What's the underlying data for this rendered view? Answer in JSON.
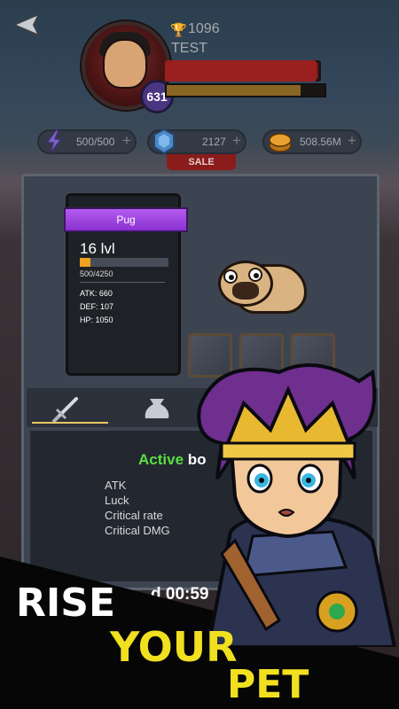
{
  "player": {
    "trophies": "1096",
    "name": "TEST",
    "level": "631",
    "hp_fraction": 0.97,
    "xp_fraction": 0.85
  },
  "resources": {
    "energy": "500/500",
    "gems": "2127",
    "gold": "508.56M",
    "plus": "+",
    "sale_label": "SALE"
  },
  "pet": {
    "name": "Pug",
    "level": "16 lvl",
    "xp_text": "500/4250",
    "xp_fraction": 0.12,
    "stats": {
      "atk": "ATK: 660",
      "def": "DEF: 107",
      "hp": "HP: 1050"
    }
  },
  "bonus": {
    "title_active": "Active",
    "title_rest": "bo",
    "lines": [
      "ATK",
      "Luck",
      "Critical rate",
      "Critical DMG"
    ],
    "timer": "d 00:59"
  },
  "promo": {
    "line1": "RISE",
    "line2": "YOUR",
    "line3": "PET"
  },
  "icons": {
    "back": "back-arrow-icon",
    "trophy": "trophy-icon",
    "energy": "lightning-icon",
    "gem": "gem-icon",
    "gold": "gold-coin-icon",
    "sword": "sword-icon",
    "bag": "bag-icon"
  },
  "colors": {
    "accent_purple": "#9b3fe0",
    "active_green": "#5ae040",
    "promo_yellow": "#f0e020",
    "xp_orange": "#f0a020"
  }
}
